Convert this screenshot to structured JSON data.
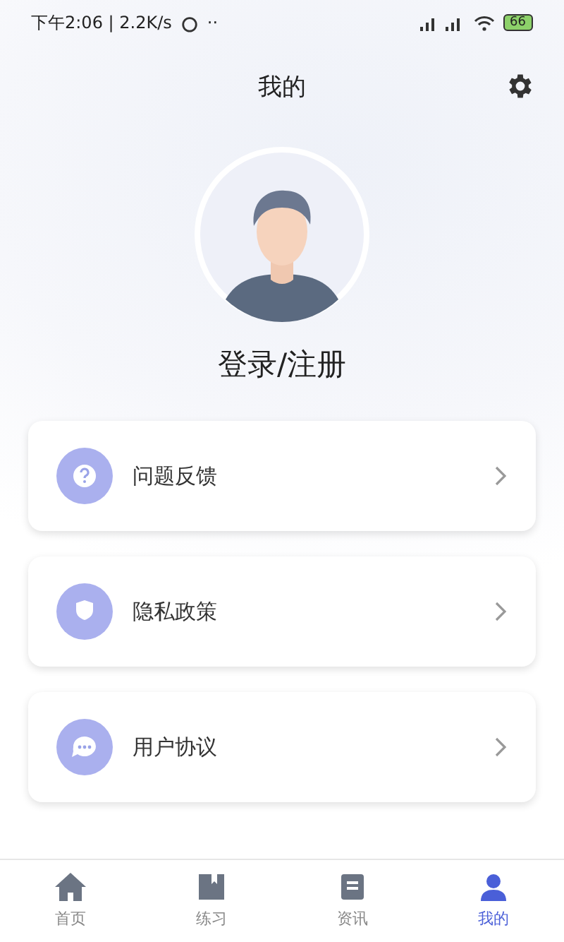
{
  "status_bar": {
    "time": "下午2:06 | 2.2K/s",
    "dots": "··",
    "battery": "66"
  },
  "header": {
    "title": "我的"
  },
  "profile": {
    "login": "登录/注册"
  },
  "menu": [
    {
      "kind": "feedback",
      "label": "问题反馈"
    },
    {
      "kind": "privacy",
      "label": "隐私政策"
    },
    {
      "kind": "agreement",
      "label": "用户协议"
    }
  ],
  "tabs": [
    {
      "kind": "home",
      "label": "首页",
      "selected": false
    },
    {
      "kind": "practice",
      "label": "练习",
      "selected": false
    },
    {
      "kind": "news",
      "label": "资讯",
      "selected": false
    },
    {
      "kind": "mine",
      "label": "我的",
      "selected": true
    }
  ]
}
